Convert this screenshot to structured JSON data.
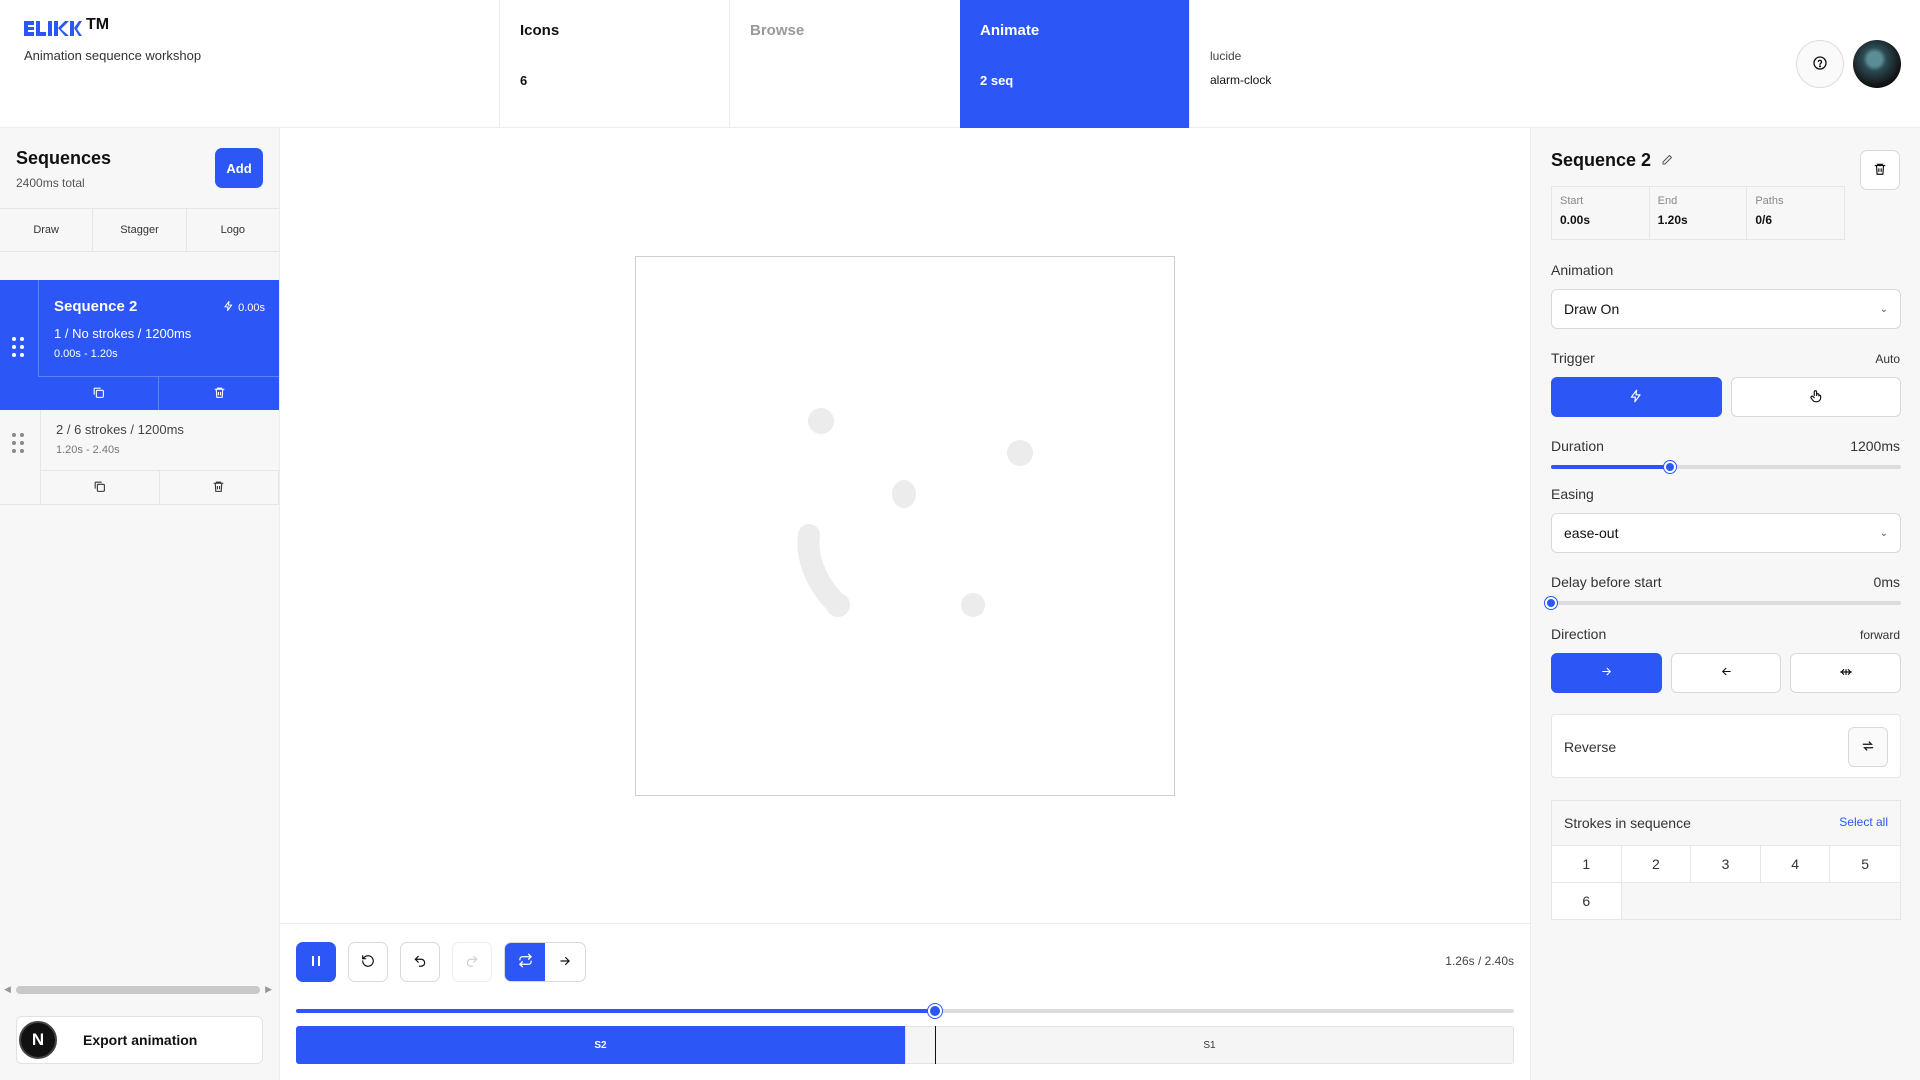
{
  "brand": {
    "tm": "TM",
    "subtitle": "Animation sequence workshop"
  },
  "nav": [
    {
      "label": "Icons",
      "value": "6"
    },
    {
      "label": "Browse",
      "value": ""
    },
    {
      "label": "Animate",
      "value": "2 seq"
    }
  ],
  "icon_meta": {
    "library": "lucide",
    "name": "alarm-clock"
  },
  "header_icons": {
    "help": "help-circle-icon"
  },
  "sidebar": {
    "title": "Sequences",
    "total": "2400ms total",
    "add_label": "Add",
    "presets": [
      "Draw",
      "Stagger",
      "Logo"
    ],
    "sequences": [
      {
        "name": "Sequence 2",
        "start": "0.00s",
        "info": "1 / No strokes / 1200ms",
        "range": "0.00s - 1.20s",
        "active": true
      },
      {
        "name": "",
        "start": "",
        "info": "2 / 6 strokes / 1200ms",
        "range": "1.20s - 2.40s",
        "active": false
      }
    ],
    "export_badge": "N",
    "export_label": "Export animation"
  },
  "timeline": {
    "time_readout": "1.26s / 2.40s",
    "progress": 0.525,
    "segments": [
      {
        "label": "S2",
        "fraction": 0.5
      },
      {
        "label": "S1",
        "fraction": 0.5
      }
    ],
    "accent": "#2c56f5"
  },
  "panel": {
    "title": "Sequence 2",
    "stats": [
      {
        "key": "Start",
        "value": "0.00s"
      },
      {
        "key": "End",
        "value": "1.20s"
      },
      {
        "key": "Paths",
        "value": "0/6"
      }
    ],
    "animation_label": "Animation",
    "animation_value": "Draw On",
    "trigger_label": "Trigger",
    "trigger_value": "Auto",
    "duration_label": "Duration",
    "duration_value": "1200ms",
    "duration_fraction": 0.34,
    "easing_label": "Easing",
    "easing_value": "ease-out",
    "delay_label": "Delay before start",
    "delay_value": "0ms",
    "delay_fraction": 0.0,
    "direction_label": "Direction",
    "direction_value": "forward",
    "reverse_label": "Reverse",
    "strokes_label": "Strokes in sequence",
    "select_all": "Select all",
    "strokes": [
      "1",
      "2",
      "3",
      "4",
      "5",
      "6"
    ]
  }
}
